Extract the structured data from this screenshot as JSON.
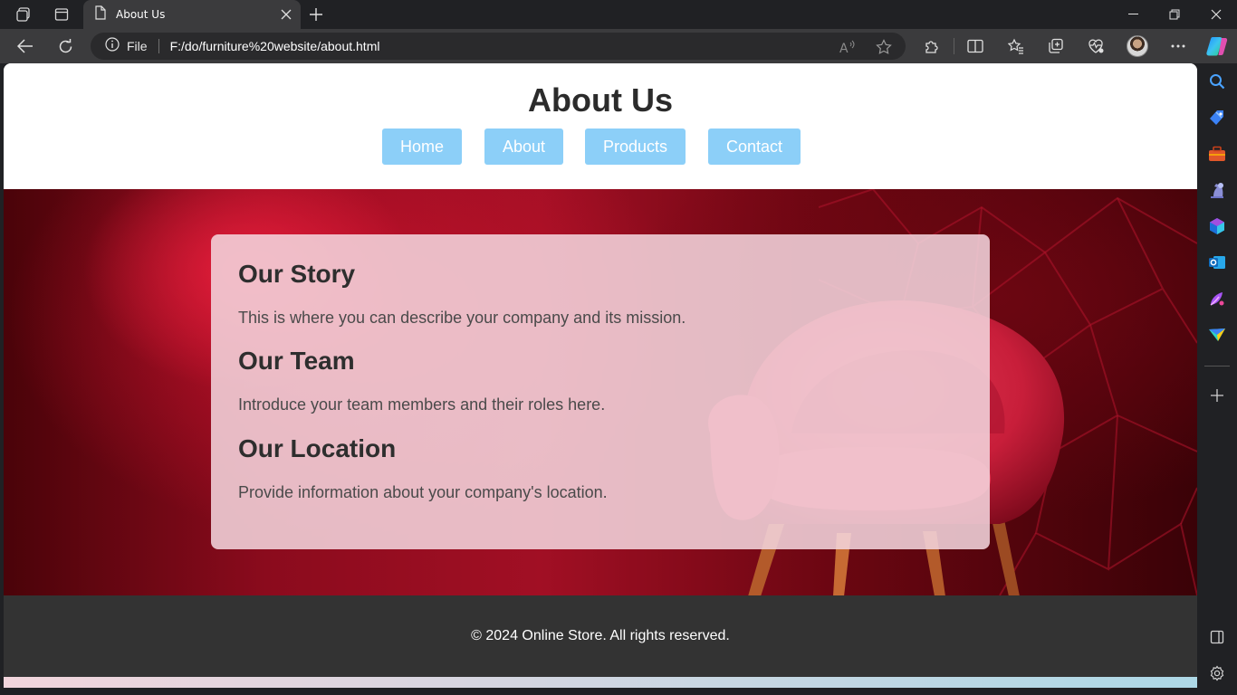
{
  "browser": {
    "tab_title": "About Us",
    "address_scheme": "File",
    "address_url": "F:/do/furniture%20website/about.html"
  },
  "site": {
    "title": "About Us",
    "nav": [
      "Home",
      "About",
      "Products",
      "Contact"
    ],
    "nav_color": "#8ccff8",
    "sections": [
      {
        "heading": "Our Story",
        "text": "This is where you can describe your company and its mission."
      },
      {
        "heading": "Our Team",
        "text": "Introduce your team members and their roles here."
      },
      {
        "heading": "Our Location",
        "text": "Provide information about your company's location."
      }
    ],
    "footer": "© 2024 Online Store. All rights reserved."
  },
  "icons": {
    "tabbar": [
      "workspaces-icon",
      "tab-actions-icon",
      "page-icon",
      "close-icon",
      "new-tab-icon"
    ],
    "window": [
      "minimize-icon",
      "restore-icon",
      "close-window-icon"
    ],
    "toolbar": [
      "back-icon",
      "refresh-icon",
      "info-icon",
      "read-aloud-icon",
      "favorite-star-icon",
      "extensions-icon",
      "split-screen-icon",
      "favorites-icon",
      "collections-icon",
      "browser-essentials-icon",
      "profile-avatar",
      "more-icon",
      "copilot-icon"
    ],
    "sidebar": [
      "search-icon",
      "shopping-icon",
      "tools-icon",
      "games-icon",
      "m365-icon",
      "outlook-icon",
      "designer-icon",
      "drop-icon",
      "add-icon",
      "hide-sidebar-icon",
      "settings-icon"
    ]
  }
}
